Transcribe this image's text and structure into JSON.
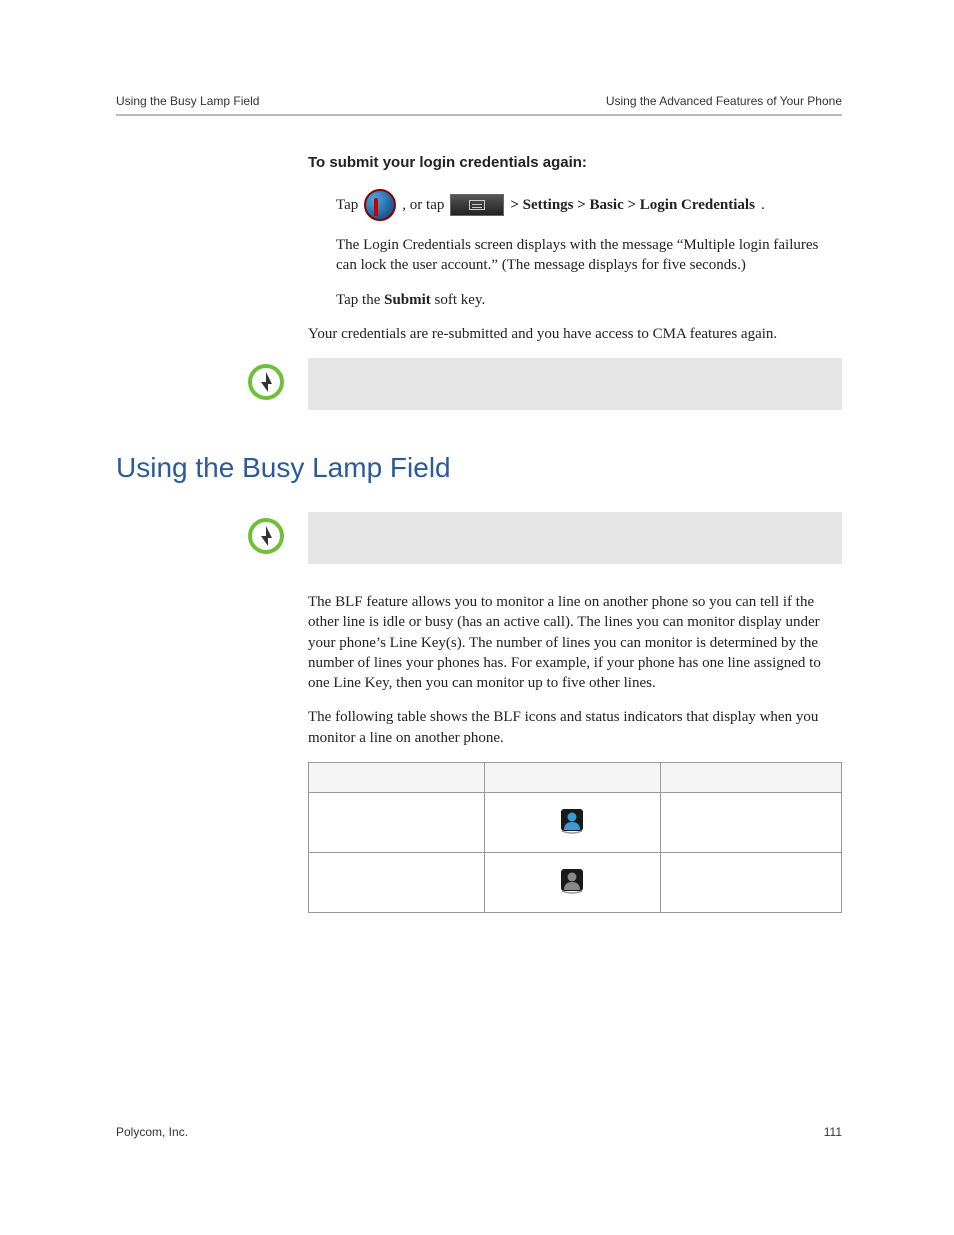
{
  "header": {
    "left": "Using the Busy Lamp Field",
    "right": "Using the Advanced Features of Your Phone"
  },
  "section1": {
    "heading": "To submit your login credentials again:",
    "step1": {
      "tap_text": "Tap",
      "or_tap": " , or tap ",
      "path_prefix": " > ",
      "path": "Settings > Basic > Login Credentials",
      "period": "."
    },
    "step1_desc": "The Login Credentials screen displays with the message “Multiple login failures can lock the user account.” (The message displays for five seconds.)",
    "step2_prefix": "Tap the ",
    "step2_bold": "Submit",
    "step2_suffix": " soft key.",
    "result": "Your credentials are re-submitted and you have access to CMA features again."
  },
  "section2": {
    "title": "Using the Busy Lamp Field",
    "para1": "The BLF feature allows you to monitor a line on another phone so you can tell if the other line is idle or busy (has an active call). The lines you can monitor display under your phone’s Line Key(s). The number of lines you can monitor is determined by the number of lines your phones has. For example, if your phone has one line assigned to one Line Key, then you can monitor up to five other lines.",
    "para2": "The following table shows the BLF icons and status indicators that display when you monitor a line on another phone."
  },
  "table": {
    "headers": [
      "",
      "",
      ""
    ],
    "rows": [
      {
        "c1": "",
        "c2_icon": "person-blue",
        "c3": ""
      },
      {
        "c1": "",
        "c2_icon": "person-gray",
        "c3": ""
      }
    ]
  },
  "footer": {
    "left": "Polycom, Inc.",
    "right": "111"
  },
  "icons": {
    "lock": "lock-icon",
    "menu": "menu-button-icon",
    "power": "power-tip-icon",
    "person_blue": "person-blue-icon",
    "person_gray": "person-gray-icon"
  }
}
